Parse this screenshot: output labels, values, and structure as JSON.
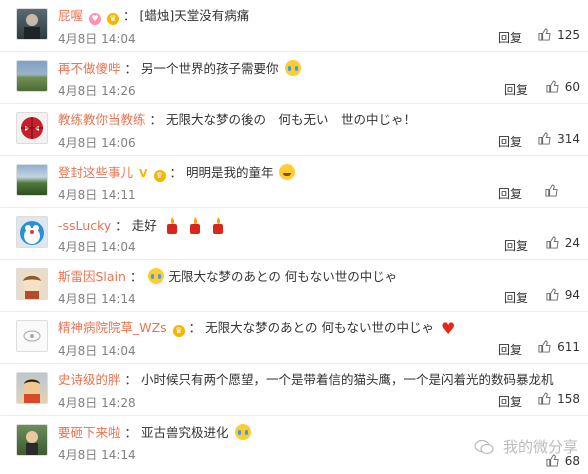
{
  "comments": [
    {
      "user": "屁喔",
      "content": "[蜡烛]天堂没有病痛",
      "time": "4月8日 14:04",
      "reply": "回复",
      "likes": "125"
    },
    {
      "user": "再不做傻哔",
      "content": "另一个世界的孩子需要你",
      "time": "4月8日 14:26",
      "reply": "回复",
      "likes": "60"
    },
    {
      "user": "教练教你当教练",
      "content": "无限大な梦の後の　何も无い　世の中じゃ！",
      "time": "4月8日 14:06",
      "reply": "回复",
      "likes": "314"
    },
    {
      "user": "登封这些事儿",
      "content": "明明是我的童年",
      "time": "4月8日 14:11",
      "reply": "回复",
      "likes": ""
    },
    {
      "user": "-ssLucky",
      "content": "走好",
      "time": "4月8日 14:04",
      "reply": "回复",
      "likes": "24"
    },
    {
      "user": "斯雷因Slain",
      "content": "无限大な梦のあとの 何もない世の中じゃ",
      "time": "4月8日 14:14",
      "reply": "回复",
      "likes": "94"
    },
    {
      "user": "精神病院院草_WZs",
      "content": "无限大な梦のあとの 何もない世の中じゃ",
      "time": "4月8日 14:04",
      "reply": "回复",
      "likes": "611"
    },
    {
      "user": "史诗级的胖",
      "content": "小时候只有两个愿望，一个是带着信的猫头鹰，一个是闪着光的数码暴龙机",
      "time": "4月8日 14:28",
      "reply": "回复",
      "likes": "158"
    },
    {
      "user": "要砸下来啦",
      "content": "亚古兽究极进化",
      "time": "4月8日 14:14",
      "reply": "回复",
      "likes": "68"
    }
  ],
  "separator": "：",
  "watermark": "我的微分享",
  "colors": {
    "username": "#eb7350",
    "meta": "#808080",
    "text": "#333333"
  }
}
